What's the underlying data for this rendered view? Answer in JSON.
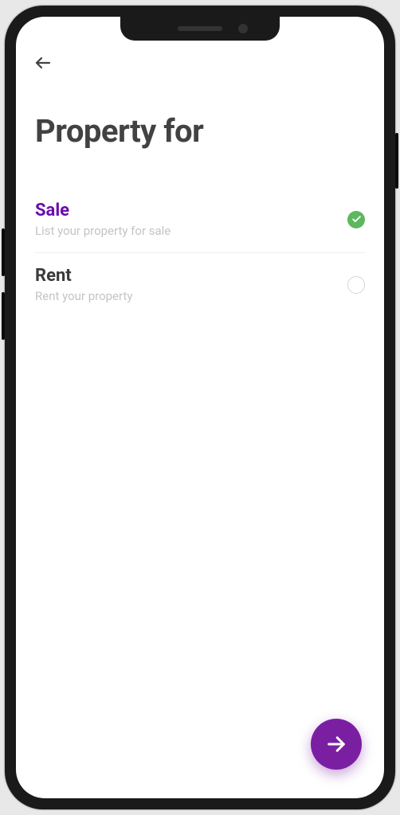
{
  "page": {
    "title": "Property for"
  },
  "options": [
    {
      "label": "Sale",
      "description": "List your property for sale",
      "selected": true
    },
    {
      "label": "Rent",
      "description": "Rent your property",
      "selected": false
    }
  ]
}
